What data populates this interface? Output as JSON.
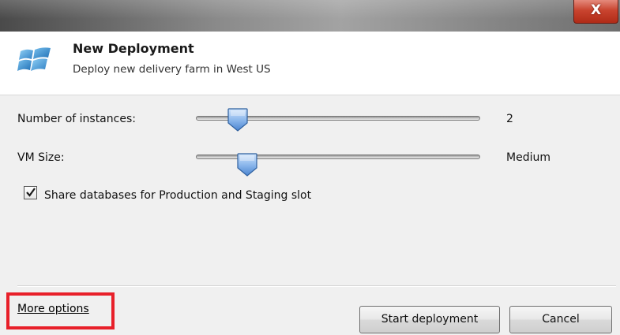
{
  "window": {
    "close_label": "X"
  },
  "header": {
    "title": "New Deployment",
    "subtitle": "Deploy new delivery farm in West US",
    "icon": "windows-logo-icon"
  },
  "form": {
    "instances": {
      "label": "Number of instances:",
      "value": "2"
    },
    "vm_size": {
      "label": "VM Size:",
      "value": "Medium"
    },
    "share_db": {
      "label": "Share databases for Production and Staging slot",
      "checked": true
    }
  },
  "footer": {
    "more_options": "More options",
    "start_button": "Start deployment",
    "cancel_button": "Cancel"
  },
  "colors": {
    "highlight": "#e8202a",
    "close_button": "#c9442f",
    "thumb": "#5b8fd6"
  }
}
